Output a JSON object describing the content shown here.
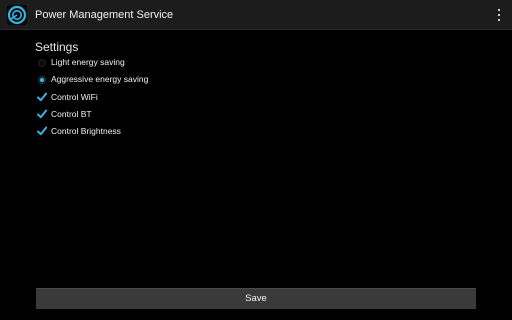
{
  "app_bar": {
    "title": "Power Management Service",
    "icon": "power-app-icon",
    "menu_icon": "overflow-menu-icon"
  },
  "settings": {
    "heading": "Settings",
    "energy_mode": {
      "options": [
        {
          "label": "Light energy saving",
          "selected": false
        },
        {
          "label": "Aggressive energy saving",
          "selected": true
        }
      ]
    },
    "toggles": [
      {
        "label": "Control WiFi",
        "checked": true
      },
      {
        "label": "Control BT",
        "checked": true
      },
      {
        "label": "Control Brightness",
        "checked": true
      }
    ]
  },
  "footer": {
    "save_label": "Save"
  },
  "colors": {
    "accent": "#33b5e5",
    "background": "#000000",
    "action_bar": "#1c1c1c",
    "button": "#3a3a3a"
  }
}
